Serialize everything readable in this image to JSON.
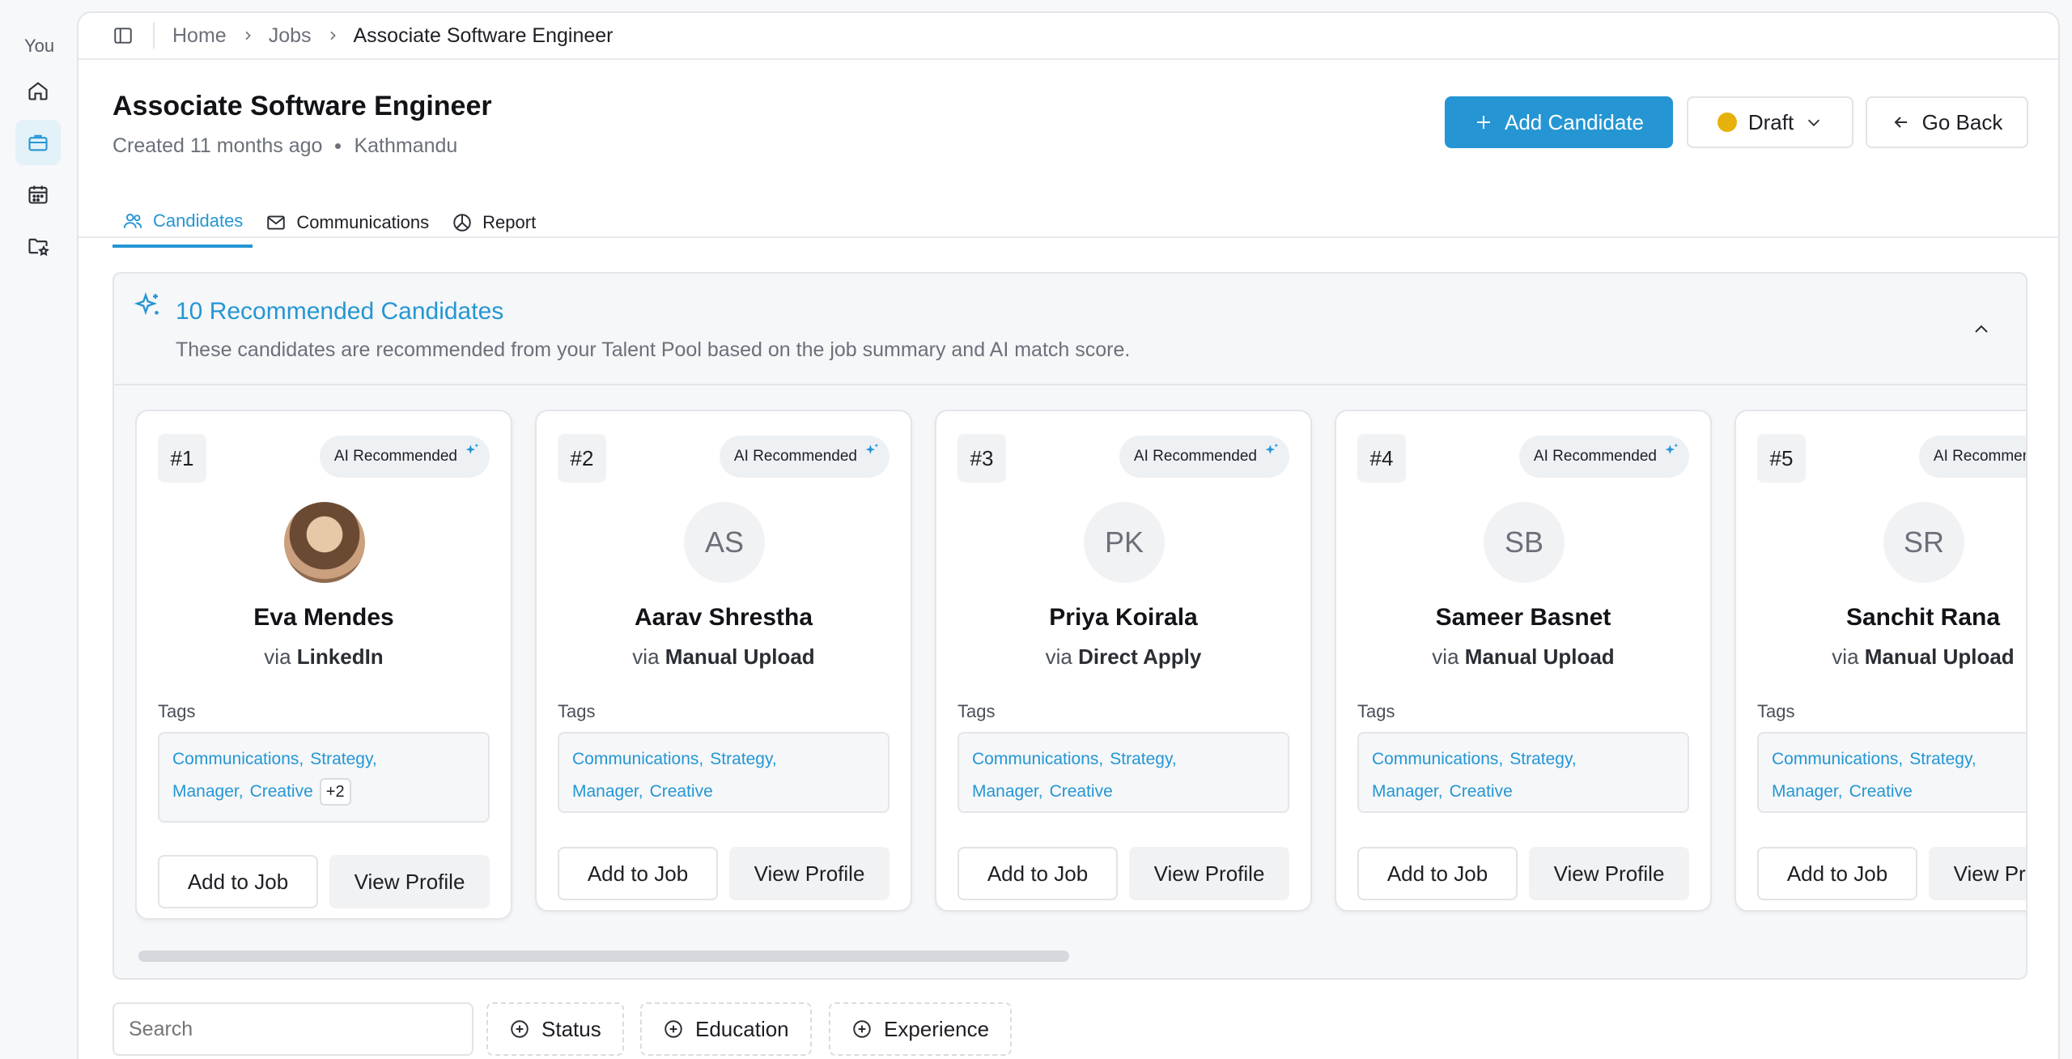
{
  "rail": {
    "you_label": "You"
  },
  "breadcrumb": {
    "home": "Home",
    "jobs": "Jobs",
    "current": "Associate Software Engineer"
  },
  "job": {
    "title": "Associate Software Engineer",
    "created": "Created 11 months ago",
    "location": "Kathmandu"
  },
  "actions": {
    "add_candidate": "Add Candidate",
    "status": "Draft",
    "go_back": "Go Back"
  },
  "tabs": [
    {
      "label": "Candidates",
      "icon": "users-icon",
      "active": true
    },
    {
      "label": "Communications",
      "icon": "mail-icon",
      "active": false
    },
    {
      "label": "Report",
      "icon": "pie-chart-icon",
      "active": false
    }
  ],
  "recommended": {
    "title": "10 Recommended Candidates",
    "subtitle": "These candidates are recommended from your Talent Pool based on the job summary and AI match score.",
    "tags_label": "Tags",
    "badge": "AI Recommended",
    "add_to_job": "Add to Job",
    "view_profile": "View Profile",
    "via": "via",
    "candidates": [
      {
        "rank": "#1",
        "initials": "",
        "name": "Eva Mendes",
        "source": "LinkedIn",
        "tags": [
          "Communications,",
          "Strategy,",
          "Manager,",
          "Creative"
        ],
        "more": "+2"
      },
      {
        "rank": "#2",
        "initials": "AS",
        "name": "Aarav Shrestha",
        "source": "Manual Upload",
        "tags": [
          "Communications,",
          "Strategy,",
          "Manager,",
          "Creative"
        ],
        "more": ""
      },
      {
        "rank": "#3",
        "initials": "PK",
        "name": "Priya Koirala",
        "source": "Direct Apply",
        "tags": [
          "Communications,",
          "Strategy,",
          "Manager,",
          "Creative"
        ],
        "more": ""
      },
      {
        "rank": "#4",
        "initials": "SB",
        "name": "Sameer Basnet",
        "source": "Manual Upload",
        "tags": [
          "Communications,",
          "Strategy,",
          "Manager,",
          "Creative"
        ],
        "more": ""
      },
      {
        "rank": "#5",
        "initials": "SR",
        "name": "Sanchit Rana",
        "source": "Manual Upload",
        "tags": [
          "Communications,",
          "Strategy,",
          "Manager,",
          "Creative"
        ],
        "more": ""
      }
    ]
  },
  "filters": {
    "search_placeholder": "Search",
    "status": "Status",
    "education": "Education",
    "experience": "Experience"
  },
  "colors": {
    "accent": "#2596d3",
    "draft": "#e6b10a"
  }
}
